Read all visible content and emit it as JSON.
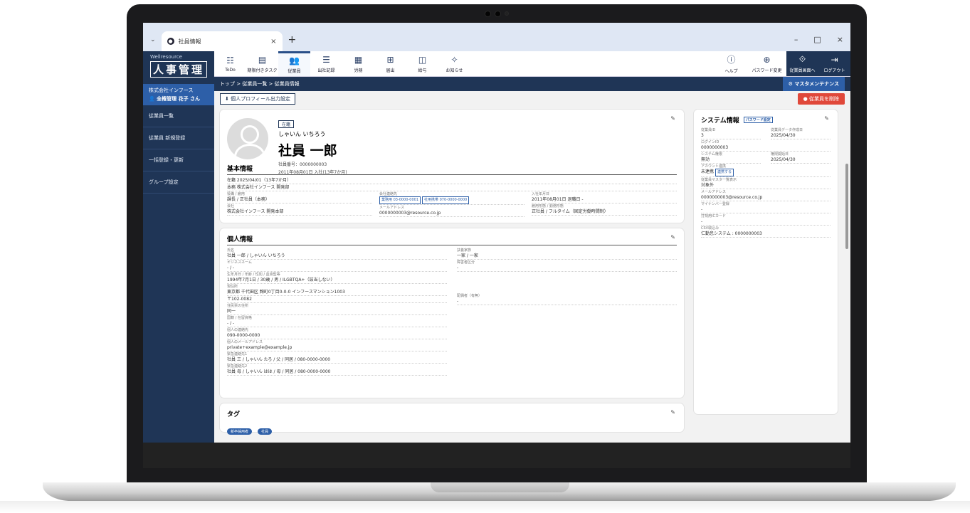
{
  "browser": {
    "tab_title": "社員情報",
    "new_tab": "+",
    "tab_close": "×",
    "win_min": "–",
    "win_max": "□",
    "win_close": "×"
  },
  "sidebar": {
    "brand": "Wellresource",
    "title": "人事管理",
    "company": "株式会社インフース",
    "user": "全権管理 花子 さん",
    "items": [
      {
        "label": "従業員一覧"
      },
      {
        "label": "従業員 新規登録"
      },
      {
        "label": "一括登録・更新"
      },
      {
        "label": "グループ設定"
      }
    ]
  },
  "toolbar": {
    "items": [
      {
        "label": "ToDo",
        "icon": "☷"
      },
      {
        "label": "期限付きタスク",
        "icon": "▤"
      },
      {
        "label": "従業員",
        "icon": "👥"
      },
      {
        "label": "出社記録",
        "icon": "☰"
      },
      {
        "label": "労務",
        "icon": "▦"
      },
      {
        "label": "届出",
        "icon": "⊞"
      },
      {
        "label": "給与",
        "icon": "◫"
      },
      {
        "label": "お知らせ",
        "icon": "✧"
      }
    ],
    "right": [
      {
        "label": "ヘルプ",
        "icon": "ⓘ"
      },
      {
        "label": "パスワード変更",
        "icon": "⊕"
      },
      {
        "label": "従業員画面へ",
        "icon": "⟐"
      },
      {
        "label": "ログアウト",
        "icon": "⇥"
      }
    ]
  },
  "breadcrumb": {
    "text": "トップ > 従業員一覧 > 従業員情報",
    "maintenance": "⚙ マスタメンテナンス"
  },
  "actions": {
    "export": "個人プロフィール出力設定",
    "delete": "従業員を削除"
  },
  "profile": {
    "status": "在籍",
    "kana": "しゃいん いちろう",
    "name": "社員 一郎",
    "emp_no": "社員番号：0000000003",
    "joined": "2011年08月01日 入社(13年7か月)"
  },
  "basic": {
    "title": "基本情報",
    "line1": "在籍 2025/04/01（13年7か月）",
    "line2": "本務 株式会社インフース 開発部",
    "dept_label": "役職 / 雇用",
    "dept_value": "課長 / 正社員（本務）",
    "company_label": "会社",
    "company_value": "株式会社インフース 開発本部",
    "phone_label": "会社連絡先",
    "phone_work": "業務用 03-0000-0001",
    "phone_mobile": "社用携帯 070-0000-0000",
    "mail_label": "メールアドレス",
    "mail_value": "0000000003@resource.co.jp",
    "entry_label": "入社年月日",
    "entry_value": "2011年08月01日 退職日 -",
    "employ_label": "雇用形態 / 勤務形態",
    "employ_value": "正社員 / フルタイム（固定労働時間制）"
  },
  "personal": {
    "title": "個人情報",
    "rows": [
      {
        "label": "氏名",
        "value": "社員 一郎 / しゃいん いちろう"
      },
      {
        "label": "ビジネスネーム",
        "value": "- / -"
      },
      {
        "label": "生年月日 / 年齢 / 性別 / 血液型等",
        "value": "1994年7月1日 / 30歳 / 男 / ILGBTQA+（該当しない）"
      },
      {
        "label": "現住所",
        "value": "東京都 千代田区 麹町0丁目0-0-0 インフースマンション1003"
      },
      {
        "label": "郵便番号",
        "value": "〒102-0082"
      },
      {
        "label": "住民票の住所",
        "value": "同一"
      },
      {
        "label": "国籍 / 在留資格",
        "value": "- / -"
      },
      {
        "label": "個人の連絡先",
        "value": "090-0000-0000"
      },
      {
        "label": "個人のメールアドレス",
        "value": "private+example@example.jp"
      },
      {
        "label": "緊急連絡先1",
        "value": "社員 三 / しゃいん たろ / 父 / 同居 / 080-0000-0000"
      },
      {
        "label": "緊急連絡先2",
        "value": "社員 母 / しゃいん はは / 母 / 同居 / 080-0000-0000"
      }
    ],
    "right_label": "扶養家族",
    "right_value": "一家 / 一家",
    "right_label2": "障害者区分",
    "right_value2": "-",
    "side_label": "配偶者（有無）",
    "side_value": "-"
  },
  "tags": {
    "title": "タグ",
    "items": [
      "新卒採用者",
      "社員"
    ]
  },
  "system": {
    "title": "システム情報",
    "pw_btn": "パスワード設定",
    "rows": [
      {
        "label": "従業員ID",
        "value": "3"
      },
      {
        "label": "従業員データ作成日",
        "value": "2025/04/30"
      },
      {
        "label": "ログインID",
        "value": "0000000003"
      },
      {
        "label": "システム権限",
        "value": "無効"
      },
      {
        "label": "権限開始日",
        "value": "2025/04/30"
      },
      {
        "label": "アカウント連携",
        "value": "未連携"
      },
      {
        "label": "従業員マスタ一覧表示",
        "value": "対象外"
      },
      {
        "label": "メールアドレス",
        "value": "0000000003@resource.co.jp"
      },
      {
        "label": "マイナンバー登録",
        "value": "-"
      },
      {
        "label": "打刻用ICカード",
        "value": "-"
      },
      {
        "label": "CSV取込み",
        "value": "仁勤怠システム  :  0000000003"
      }
    ],
    "link_btn": "連携する"
  }
}
